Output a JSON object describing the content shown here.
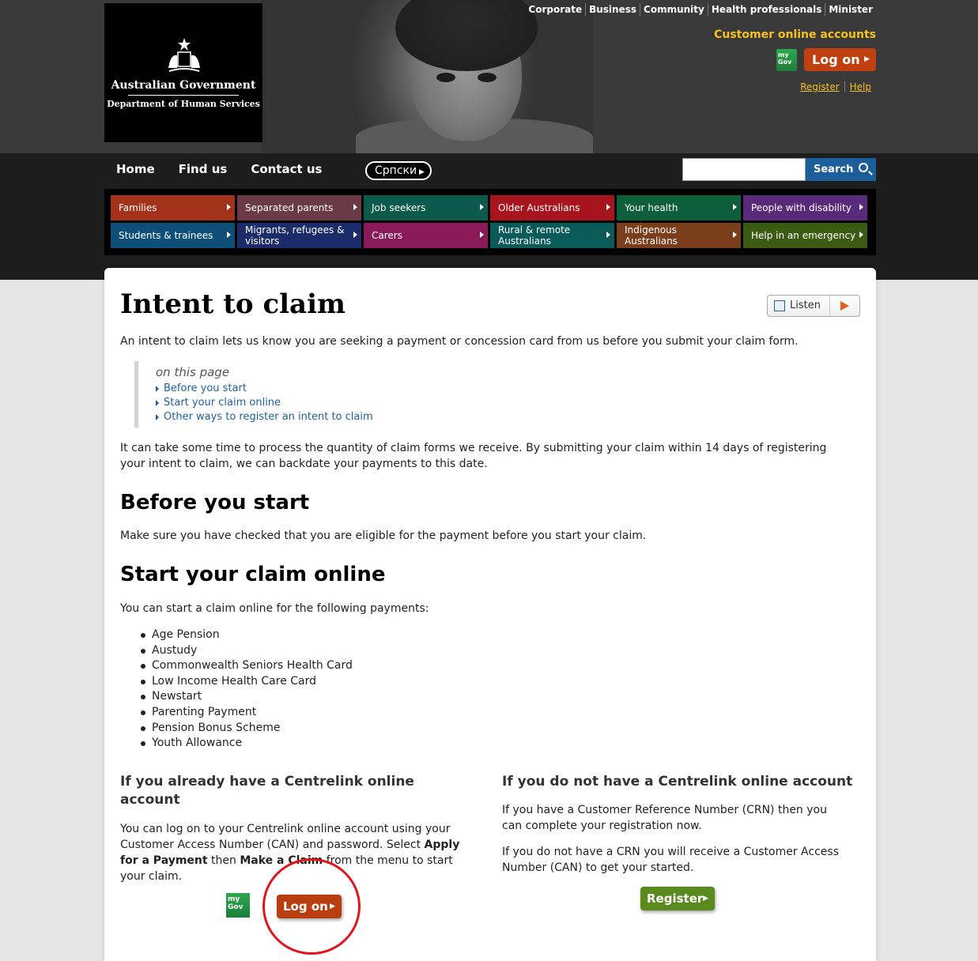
{
  "header": {
    "logo": {
      "line1": "Australian Government",
      "line2": "Department of Human Services"
    },
    "utility_links": [
      "Corporate",
      "Business",
      "Community",
      "Health professionals",
      "Minister"
    ],
    "customer_accounts_title": "Customer online accounts",
    "mygov_label": "my Gov",
    "logon_label": "Log on",
    "register_label": "Register",
    "help_label": "Help"
  },
  "nav": {
    "items": [
      "Home",
      "Find us",
      "Contact us"
    ],
    "language": "Српски",
    "search_placeholder": "",
    "search_label": "Search"
  },
  "categories": [
    {
      "label": "Families",
      "color": "#a3321a"
    },
    {
      "label": "Separated parents",
      "color": "#6b3a46"
    },
    {
      "label": "Job seekers",
      "color": "#0b5a4b"
    },
    {
      "label": "Older Australians",
      "color": "#a8141e"
    },
    {
      "label": "Your health",
      "color": "#0d5e3a"
    },
    {
      "label": "People with disability",
      "color": "#5a2a7a"
    },
    {
      "label": "Students & trainees",
      "color": "#0e4f7a"
    },
    {
      "label": "Migrants, refugees & visitors",
      "color": "#1c2c6b"
    },
    {
      "label": "Carers",
      "color": "#8a1a5a"
    },
    {
      "label": "Rural & remote Australians",
      "color": "#0b5a5a"
    },
    {
      "label": "Indigenous Australians",
      "color": "#7a3e1c"
    },
    {
      "label": "Help in an emergency",
      "color": "#3b5a12"
    }
  ],
  "page": {
    "title": "Intent to claim",
    "listen_label": "Listen",
    "intro": "An intent to claim lets us know you are seeking a payment or concession card from us before you submit your claim form.",
    "on_this_page": {
      "heading": "on this page",
      "links": [
        "Before you start",
        "Start your claim online",
        "Other ways to register an intent to claim"
      ]
    },
    "para2": "It can take some time to process the quantity of claim forms we receive. By submitting your claim within 14 days of registering your intent to claim, we can backdate your payments to this date.",
    "before_heading": "Before you start",
    "before_text": "Make sure you have checked that you are eligible for the payment before you start your claim.",
    "start_heading": "Start your claim online",
    "start_text": "You can start a claim online for the following payments:",
    "payments": [
      "Age Pension",
      "Austudy",
      "Commonwealth Seniors Health Card",
      "Low Income Health Care Card",
      "Newstart",
      "Parenting Payment",
      "Pension Bonus Scheme",
      "Youth Allowance"
    ],
    "have_account_heading": "If you already have a Centrelink online account",
    "have_account_text_1": "You can log on to your Centrelink online account using your Customer Access Number (CAN) and password. Select ",
    "have_account_bold_1": "Apply for a Payment",
    "have_account_text_2": " then ",
    "have_account_bold_2": "Make a Claim",
    "have_account_text_3": " from the menu to start your claim.",
    "no_account_heading": "If you do not have a Centrelink online account",
    "crn_text": "If you have a Customer Reference Number (CRN) then you can complete your registration now.",
    "no_crn_text": "If you do not have a CRN you will receive a Customer Access Number (CAN) to get your started.",
    "logon_button": "Log on",
    "register_button": "Register",
    "mygov_label": "my Gov"
  }
}
